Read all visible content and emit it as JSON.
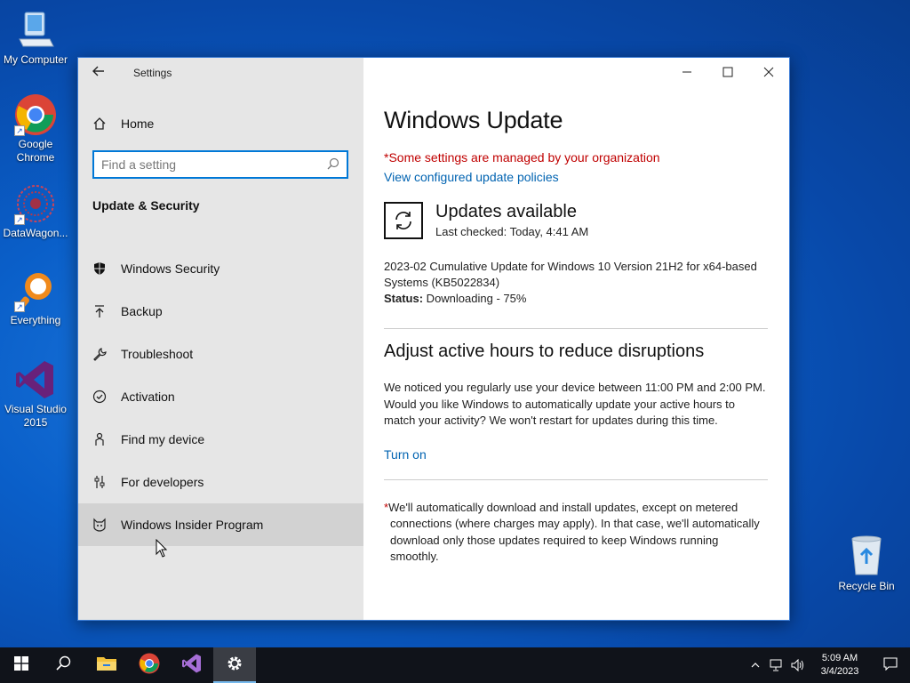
{
  "desktop": {
    "icons": [
      {
        "label": "My Computer"
      },
      {
        "label": "Google Chrome"
      },
      {
        "label": "DataWagon..."
      },
      {
        "label": "Everything"
      },
      {
        "label": "Visual Studio 2015"
      }
    ],
    "recycle_bin": "Recycle Bin"
  },
  "window": {
    "title": "Settings",
    "sidebar": {
      "home_label": "Home",
      "search_placeholder": "Find a setting",
      "section_title": "Update & Security",
      "items": [
        {
          "label": "Windows Security",
          "icon": "shield-icon"
        },
        {
          "label": "Backup",
          "icon": "backup-icon"
        },
        {
          "label": "Troubleshoot",
          "icon": "wrench-icon"
        },
        {
          "label": "Activation",
          "icon": "check-circle-icon"
        },
        {
          "label": "Find my device",
          "icon": "person-icon"
        },
        {
          "label": "For developers",
          "icon": "sliders-icon"
        },
        {
          "label": "Windows Insider Program",
          "icon": "cat-icon"
        }
      ]
    },
    "content": {
      "page_title": "Windows Update",
      "managed_notice": "*Some settings are managed by your organization",
      "policies_link": "View configured update policies",
      "update_heading": "Updates available",
      "last_checked": "Last checked: Today, 4:41 AM",
      "update_description": "2023-02 Cumulative Update for Windows 10 Version 21H2 for x64-based Systems (KB5022834)",
      "status_label": "Status:",
      "status_value": " Downloading - 75%",
      "active_hours_heading": "Adjust active hours to reduce disruptions",
      "active_hours_text": "We noticed you regularly use your device between 11:00 PM and 2:00 PM. Would you like Windows to automatically update your active hours to match your activity? We won't restart for updates during this time.",
      "turn_on_link": "Turn on",
      "note_star": "*",
      "note_text": "We'll automatically download and install updates, except on metered connections (where charges may apply). In that case, we'll automatically download only those updates required to keep Windows running smoothly."
    }
  },
  "taskbar": {
    "time": "5:09 AM",
    "date": "3/4/2023"
  },
  "colors": {
    "accent": "#0078d7",
    "link": "#0063b1",
    "warning": "#c00000",
    "taskbar": "#10131a"
  }
}
